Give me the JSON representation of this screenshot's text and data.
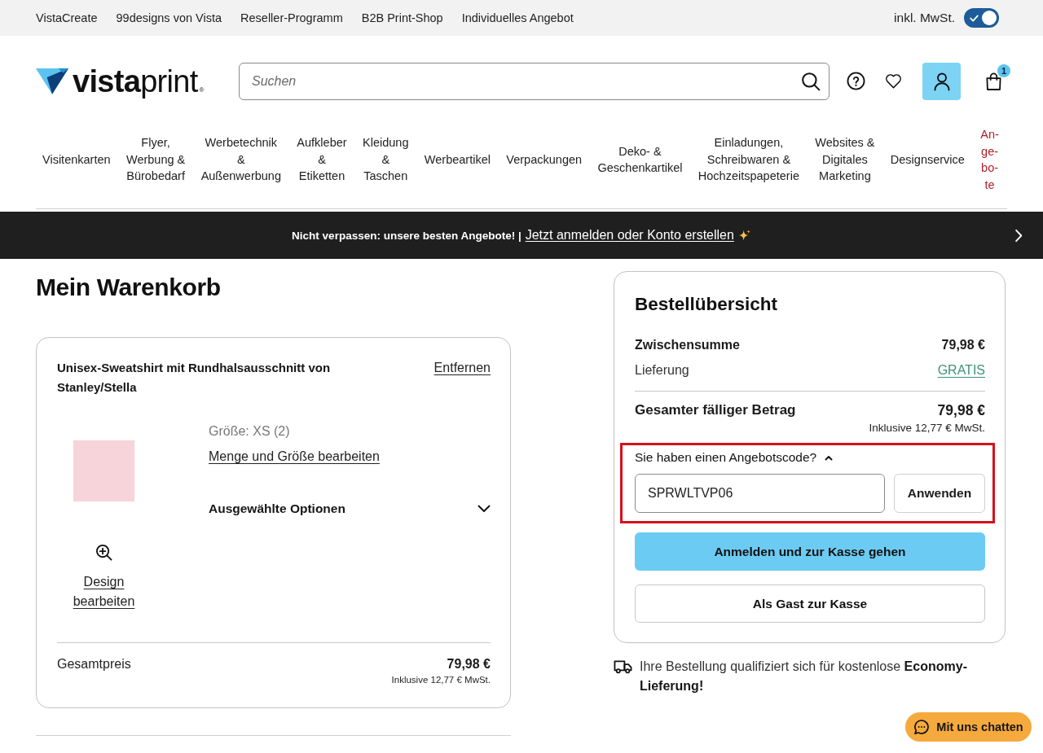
{
  "top_bar": {
    "links": [
      "VistaCreate",
      "99designs von Vista",
      "Reseller-Programm",
      "B2B Print-Shop",
      "Individuelles Angebot"
    ],
    "vat_toggle": {
      "label": "inkl. MwSt.",
      "on": true
    }
  },
  "header": {
    "logo": "**vista**print$_{®}$",
    "search": {
      "placeholder": "Suchen"
    },
    "cart_count": "1"
  },
  "nav": [
    {
      "label": "Visitenkarten",
      "highlighted": false
    },
    {
      "label": "Flyer,\nWerbung &\nBürobedarf",
      "highlighted": false
    },
    {
      "label": "Werbetechnik\n&\nAußenwerbung",
      "highlighted": false
    },
    {
      "label": "Aufkleber\n&\nEtiketten",
      "highlighted": false
    },
    {
      "label": "Kleidung\n&\nTaschen",
      "highlighted": false
    },
    {
      "label": "Werbeartikel",
      "highlighted": false
    },
    {
      "label": "Verpackungen",
      "highlighted": false
    },
    {
      "label": "Deko- &\nGeschenkartikel",
      "highlighted": false
    },
    {
      "label": "Einladungen,\nSchreibwaren &\nHochzeitspapeterie",
      "highlighted": false
    },
    {
      "label": "Websites &\nDigitales\nMarketing",
      "highlighted": false
    },
    {
      "label": "Designservice",
      "highlighted": false
    },
    {
      "label": "An-\nge-\nbo-\nte",
      "highlighted": true
    }
  ],
  "promo_banner": {
    "text": "Nicht verpassen: unsere besten Angebote! |",
    "link": "Jetzt anmelden oder Konto erstellen"
  },
  "cart": {
    "title": "Mein Warenkorb",
    "items": [
      {
        "name": "Unisex-Sweatshirt mit Rundhalsausschnitt von Stanley/Stella",
        "remove": "Entfernen",
        "size": "Größe: XS (2)",
        "edit_quantity": "Menge und Größe bearbeiten",
        "options": {
          "label": "Ausgewählte Optionen",
          "expanded": false
        },
        "edit_design": "Design bearbeiten",
        "total_label": "Gesamtpreis",
        "total": "79,98 €",
        "vat_note": "Inklusive 12,77 € MwSt."
      }
    ]
  },
  "summary": {
    "title": "Bestellübersicht",
    "rows": [
      {
        "label": "Zwischensumme",
        "value": "79,98 €",
        "kind": "amount"
      },
      {
        "label": "Lieferung",
        "value": "GRATIS",
        "kind": "link"
      }
    ],
    "total": {
      "label": "Gesamter fälliger Betrag",
      "value": "79,98 €",
      "note": "Inklusive 12,77 € MwSt."
    },
    "promo_code": {
      "label": "Sie haben einen Angebotscode?",
      "expanded": true,
      "value": "SPRWLTVP06",
      "button": "Anwenden",
      "highlighted": true
    },
    "buttons": [
      {
        "label": "Anmelden und zur Kasse gehen",
        "kind": "primary"
      },
      {
        "label": "Als Gast zur Kasse",
        "kind": "secondary"
      }
    ]
  },
  "shipping_note": "Ihre Bestellung qualifiziert sich für kostenlose **Economy-Lieferung!**",
  "chat_button": "Mit uns chatten"
}
